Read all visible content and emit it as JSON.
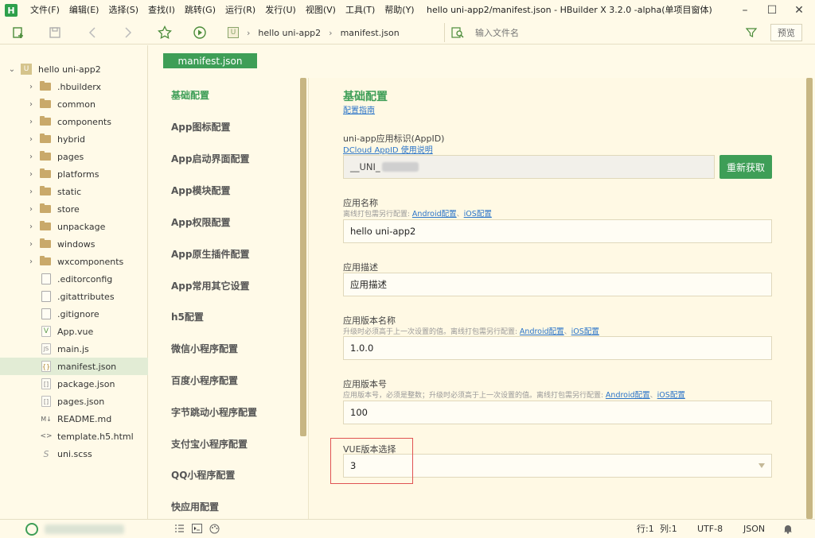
{
  "window": {
    "title": "hello uni-app2/manifest.json - HBuilder X 3.2.0 -alpha(单项目窗体)",
    "app_logo": "H",
    "controls": [
      "–",
      "☐",
      "✕"
    ]
  },
  "menu": [
    "文件(F)",
    "编辑(E)",
    "选择(S)",
    "查找(I)",
    "跳转(G)",
    "运行(R)",
    "发行(U)",
    "视图(V)",
    "工具(T)",
    "帮助(Y)"
  ],
  "toolbar": {
    "breadcrumb": [
      "hello uni-app2",
      "manifest.json"
    ],
    "breadcrumb_icon": "U",
    "search_placeholder": "输入文件名",
    "preview_label": "预览"
  },
  "tree": {
    "project": "hello uni-app2",
    "project_icon": "U",
    "folders": [
      ".hbuilderx",
      "common",
      "components",
      "hybrid",
      "pages",
      "platforms",
      "static",
      "store",
      "unpackage",
      "windows",
      "wxcomponents"
    ],
    "files": [
      {
        "name": ".editorconfig",
        "icon": ""
      },
      {
        "name": ".gitattributes",
        "icon": ""
      },
      {
        "name": ".gitignore",
        "icon": ""
      },
      {
        "name": "App.vue",
        "icon": "V"
      },
      {
        "name": "main.js",
        "icon": "JS"
      },
      {
        "name": "manifest.json",
        "icon": "{}"
      },
      {
        "name": "package.json",
        "icon": "[]"
      },
      {
        "name": "pages.json",
        "icon": "[]"
      },
      {
        "name": "README.md",
        "icon": "M↓"
      },
      {
        "name": "template.h5.html",
        "icon": "<>"
      },
      {
        "name": "uni.scss",
        "icon": "S"
      }
    ],
    "selected": "manifest.json"
  },
  "editor": {
    "tab_label": "manifest.json",
    "nav": [
      "基础配置",
      "App图标配置",
      "App启动界面配置",
      "App模块配置",
      "App权限配置",
      "App原生插件配置",
      "App常用其它设置",
      "h5配置",
      "微信小程序配置",
      "百度小程序配置",
      "字节跳动小程序配置",
      "支付宝小程序配置",
      "QQ小程序配置",
      "快应用配置"
    ],
    "active_nav": "基础配置"
  },
  "form": {
    "title": "基础配置",
    "guide_link": "配置指南",
    "appid": {
      "label": "uni-app应用标识(AppID)",
      "hint_link": "DCloud AppID 使用说明",
      "value": "__UNI_",
      "refetch": "重新获取"
    },
    "app_name": {
      "label": "应用名称",
      "hint": "离线打包需另行配置:",
      "android_link": "Android配置",
      "sep": "、",
      "ios_link": "iOS配置",
      "value": "hello uni-app2"
    },
    "app_desc": {
      "label": "应用描述",
      "value": "应用描述"
    },
    "version_name": {
      "label": "应用版本名称",
      "hint": "升级时必须高于上一次设置的值。离线打包需另行配置:",
      "android_link": "Android配置",
      "sep": "、",
      "ios_link": "iOS配置",
      "value": "1.0.0"
    },
    "version_code": {
      "label": "应用版本号",
      "hint": "应用版本号，必须是整数；升级时必须高于上一次设置的值。离线打包需另行配置:",
      "android_link": "Android配置",
      "sep": "、",
      "ios_link": "iOS配置",
      "value": "100"
    },
    "vue_version": {
      "label": "VUE版本选择",
      "value": "3"
    }
  },
  "statusbar": {
    "line": "行:1",
    "col": "列:1",
    "encoding": "UTF-8",
    "language": "JSON"
  }
}
